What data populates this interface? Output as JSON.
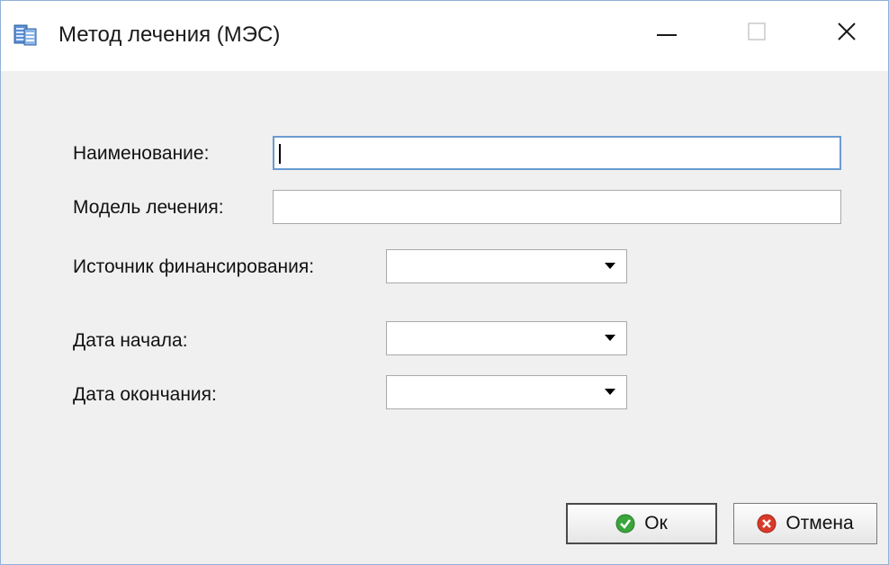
{
  "window": {
    "title": "Метод лечения (МЭС)",
    "icon": "table-grid-icon",
    "controls": {
      "minimize": "minimize-icon",
      "maximize": "maximize-icon",
      "close": "close-icon"
    }
  },
  "form": {
    "name_label": "Наименование:",
    "name_value": "",
    "model_label": "Модель лечения:",
    "model_value": "",
    "funding_label": "Источник финансирования:",
    "funding_value": "",
    "start_date_label": "Дата начала:",
    "start_date_value": "",
    "end_date_label": "Дата окончания:",
    "end_date_value": ""
  },
  "buttons": {
    "ok_label": "Ок",
    "ok_icon": "check-circle-icon",
    "cancel_label": "Отмена",
    "cancel_icon": "cancel-circle-icon"
  },
  "colors": {
    "window_border": "#8fb2d9",
    "focus_border": "#6a9bd1",
    "ok_green": "#3aa53a",
    "cancel_red": "#d83a2a"
  }
}
